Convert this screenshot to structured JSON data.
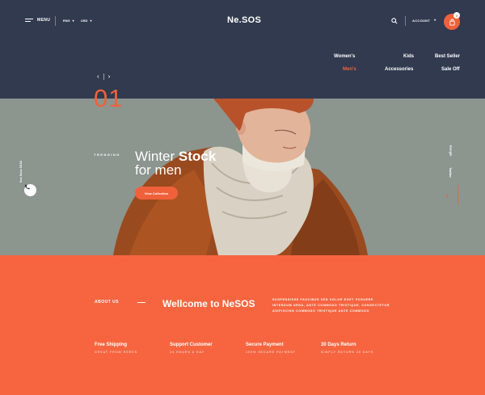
{
  "header": {
    "menu_label": "MENU",
    "language": "ENG",
    "currency": "USD",
    "logo": "Ne.SOS",
    "account_label": "ACCOUNT",
    "cart_count": "0"
  },
  "nav": {
    "items": [
      {
        "label": "Women's"
      },
      {
        "label": "Kids"
      },
      {
        "label": "Best Seller"
      },
      {
        "label": "Men's"
      },
      {
        "label": "Accessories"
      },
      {
        "label": "Sale Off"
      }
    ],
    "active": "Men's"
  },
  "slider": {
    "number": "01",
    "prev_icon": "chevron-left-icon",
    "next_icon": "chevron-right-icon"
  },
  "hero": {
    "tag": "TRENDING",
    "title_regular": "Winter",
    "title_bold": "Stock",
    "title_line2": "for men",
    "cta_label": "View Collection",
    "phone": "0xx 0xxx 0234",
    "social": [
      "Google",
      "Twitter",
      "Fb"
    ]
  },
  "about": {
    "label": "ABOUT US",
    "heading": "Wellcome to NeSOS",
    "text": "SUSPENDISSE FAUCIBUS SED DOLOR EGET POSUERE INTERDUM URNA, ANTE COMMODO TRISTIQUE, CONSECTETUR ADIPISCING COMMODO TRISTIQUE ANTE COMMODO"
  },
  "features": [
    {
      "title": "Free Shipping",
      "sub": "GREAT FROM HERES"
    },
    {
      "title": "Support Customer",
      "sub": "24 HOURS A DAY"
    },
    {
      "title": "Secure Payment",
      "sub": "100% SECURE PAYMENT"
    },
    {
      "title": "30 Days Return",
      "sub": "SIMPLY RETURN 30 DAYS"
    }
  ],
  "colors": {
    "header_bg": "#313a4f",
    "accent": "#f0613b",
    "footer_bg": "#f66540",
    "hero_bg": "#8c958e"
  }
}
